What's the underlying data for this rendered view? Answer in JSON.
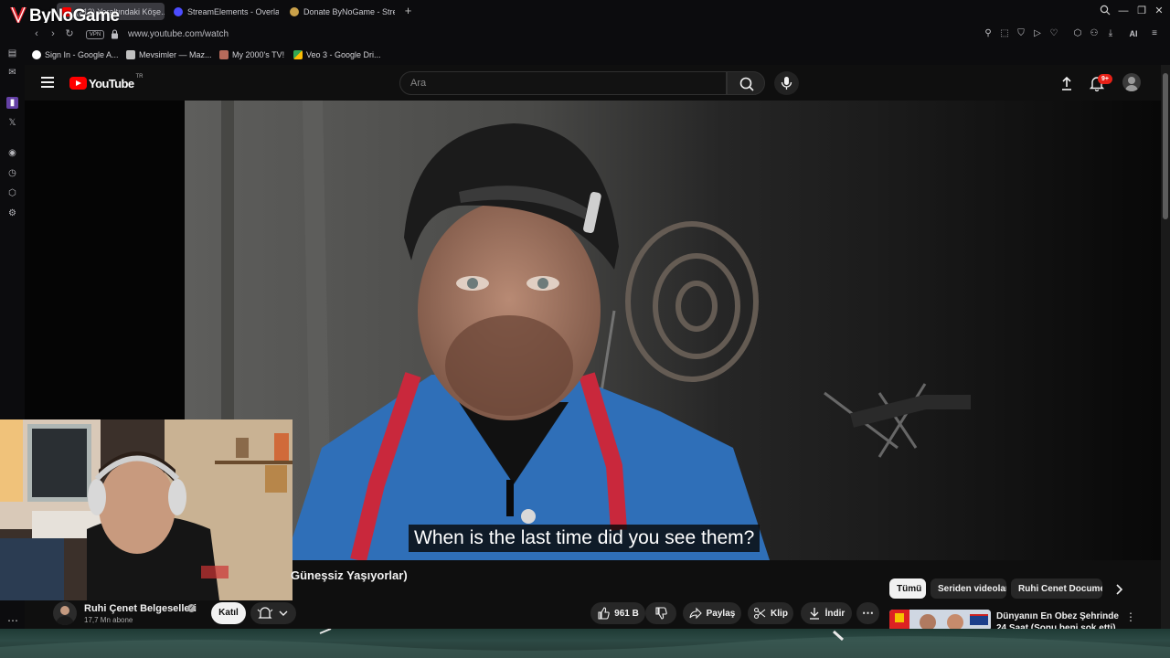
{
  "browser": {
    "brand_overlay": "ByNoGame",
    "tabs": [
      {
        "label": "(213) Yeraltındaki Köşe...",
        "active": true
      },
      {
        "label": "StreamElements - Overlay",
        "active": false
      },
      {
        "label": "Donate ByNoGame - Strea...",
        "active": false
      }
    ],
    "vpn_label": "VPN",
    "url": "www.youtube.com/watch",
    "ai_label": "AI",
    "bookmarks": [
      {
        "label": "Sign In - Google A...",
        "color": "#ffffff"
      },
      {
        "label": "Mevsimler — Maz...",
        "color": "#c0c0c0"
      },
      {
        "label": "My 2000's TV!",
        "color": "#b86b5b"
      },
      {
        "label": "Veo 3 - Google Dri...",
        "color": "#34a853"
      }
    ]
  },
  "youtube": {
    "logo_text": "YouTube",
    "region": "TR",
    "search_placeholder": "Ara",
    "notifications_badge": "9+",
    "subtitle": "When is the last time did you see them?",
    "video_title_fragment": "Güneşsiz Yaşıyorlar)",
    "channel": {
      "name": "Ruhi Çenet Belgeselleri",
      "subscribers": "17,7 Mn abone",
      "join_label": "Katıl"
    },
    "actions": {
      "likes": "961 B",
      "share": "Paylaş",
      "clip": "Klip",
      "download": "İndir"
    },
    "chips": [
      {
        "label": "Tümü",
        "selected": true
      },
      {
        "label": "Seriden videolar",
        "selected": false
      },
      {
        "label": "Ruhi Cenet Documen...",
        "selected": false
      }
    ],
    "recommended": {
      "title": "Dünyanın En Obez Şehrinde 24 Saat (Sonu beni şok etti)"
    }
  },
  "colors": {
    "youtube_red": "#ff0000",
    "background": "#0f0f0f",
    "badge_red": "#e62117"
  }
}
